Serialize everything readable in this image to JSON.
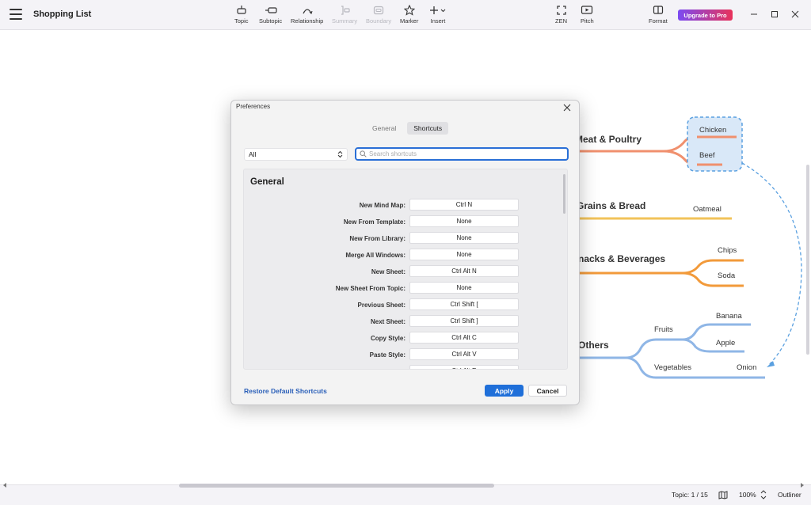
{
  "app": {
    "document_title": "Shopping List",
    "upgrade_label": "Upgrade to Pro"
  },
  "toolbar": {
    "topic": "Topic",
    "subtopic": "Subtopic",
    "relationship": "Relationship",
    "summary": "Summary",
    "boundary": "Boundary",
    "marker": "Marker",
    "insert": "Insert",
    "zen": "ZEN",
    "pitch": "Pitch",
    "format": "Format"
  },
  "mindmap": {
    "branches": [
      {
        "label": "Meat & Poultry",
        "color": "#f0906e",
        "children": [
          "Chicken",
          "Beef"
        ]
      },
      {
        "label": "Grains & Bread",
        "color": "#f2c35a",
        "children": [
          "Oatmeal"
        ]
      },
      {
        "label": "nacks & Beverages",
        "color": "#f29a3a",
        "children": [
          "Chips",
          "Soda"
        ]
      },
      {
        "label": "Others",
        "color": "#8fb6e6",
        "children": [
          "Fruits",
          "Vegetables"
        ],
        "fruits": [
          "Banana",
          "Apple"
        ],
        "vegetables": [
          "Onion"
        ]
      }
    ],
    "boundary_color": "#5aa0e0"
  },
  "dialog": {
    "title": "Preferences",
    "tabs": [
      "General",
      "Shortcuts"
    ],
    "active_tab": "Shortcuts",
    "filter_value": "All",
    "search_placeholder": "Search shortcuts",
    "section": "General",
    "shortcuts": [
      {
        "label": "New Mind Map:",
        "key": "Ctrl N"
      },
      {
        "label": "New From Template:",
        "key": "None"
      },
      {
        "label": "New From Library:",
        "key": "None"
      },
      {
        "label": "Merge All Windows:",
        "key": "None"
      },
      {
        "label": "New Sheet:",
        "key": "Ctrl Alt N"
      },
      {
        "label": "New Sheet From Topic:",
        "key": "None"
      },
      {
        "label": "Previous Sheet:",
        "key": "Ctrl Shift ["
      },
      {
        "label": "Next Sheet:",
        "key": "Ctrl Shift ]"
      },
      {
        "label": "Copy Style:",
        "key": "Ctrl Alt C"
      },
      {
        "label": "Paste Style:",
        "key": "Ctrl Alt V"
      },
      {
        "label": "Reset Style:",
        "key": "Ctrl Alt R"
      }
    ],
    "restore_label": "Restore Default Shortcuts",
    "apply_label": "Apply",
    "cancel_label": "Cancel"
  },
  "status": {
    "topic_count": "Topic: 1 / 15",
    "zoom": "100%",
    "outliner": "Outliner"
  },
  "colors": {
    "accent": "#1f6fd9",
    "link": "#2a5fb8"
  }
}
